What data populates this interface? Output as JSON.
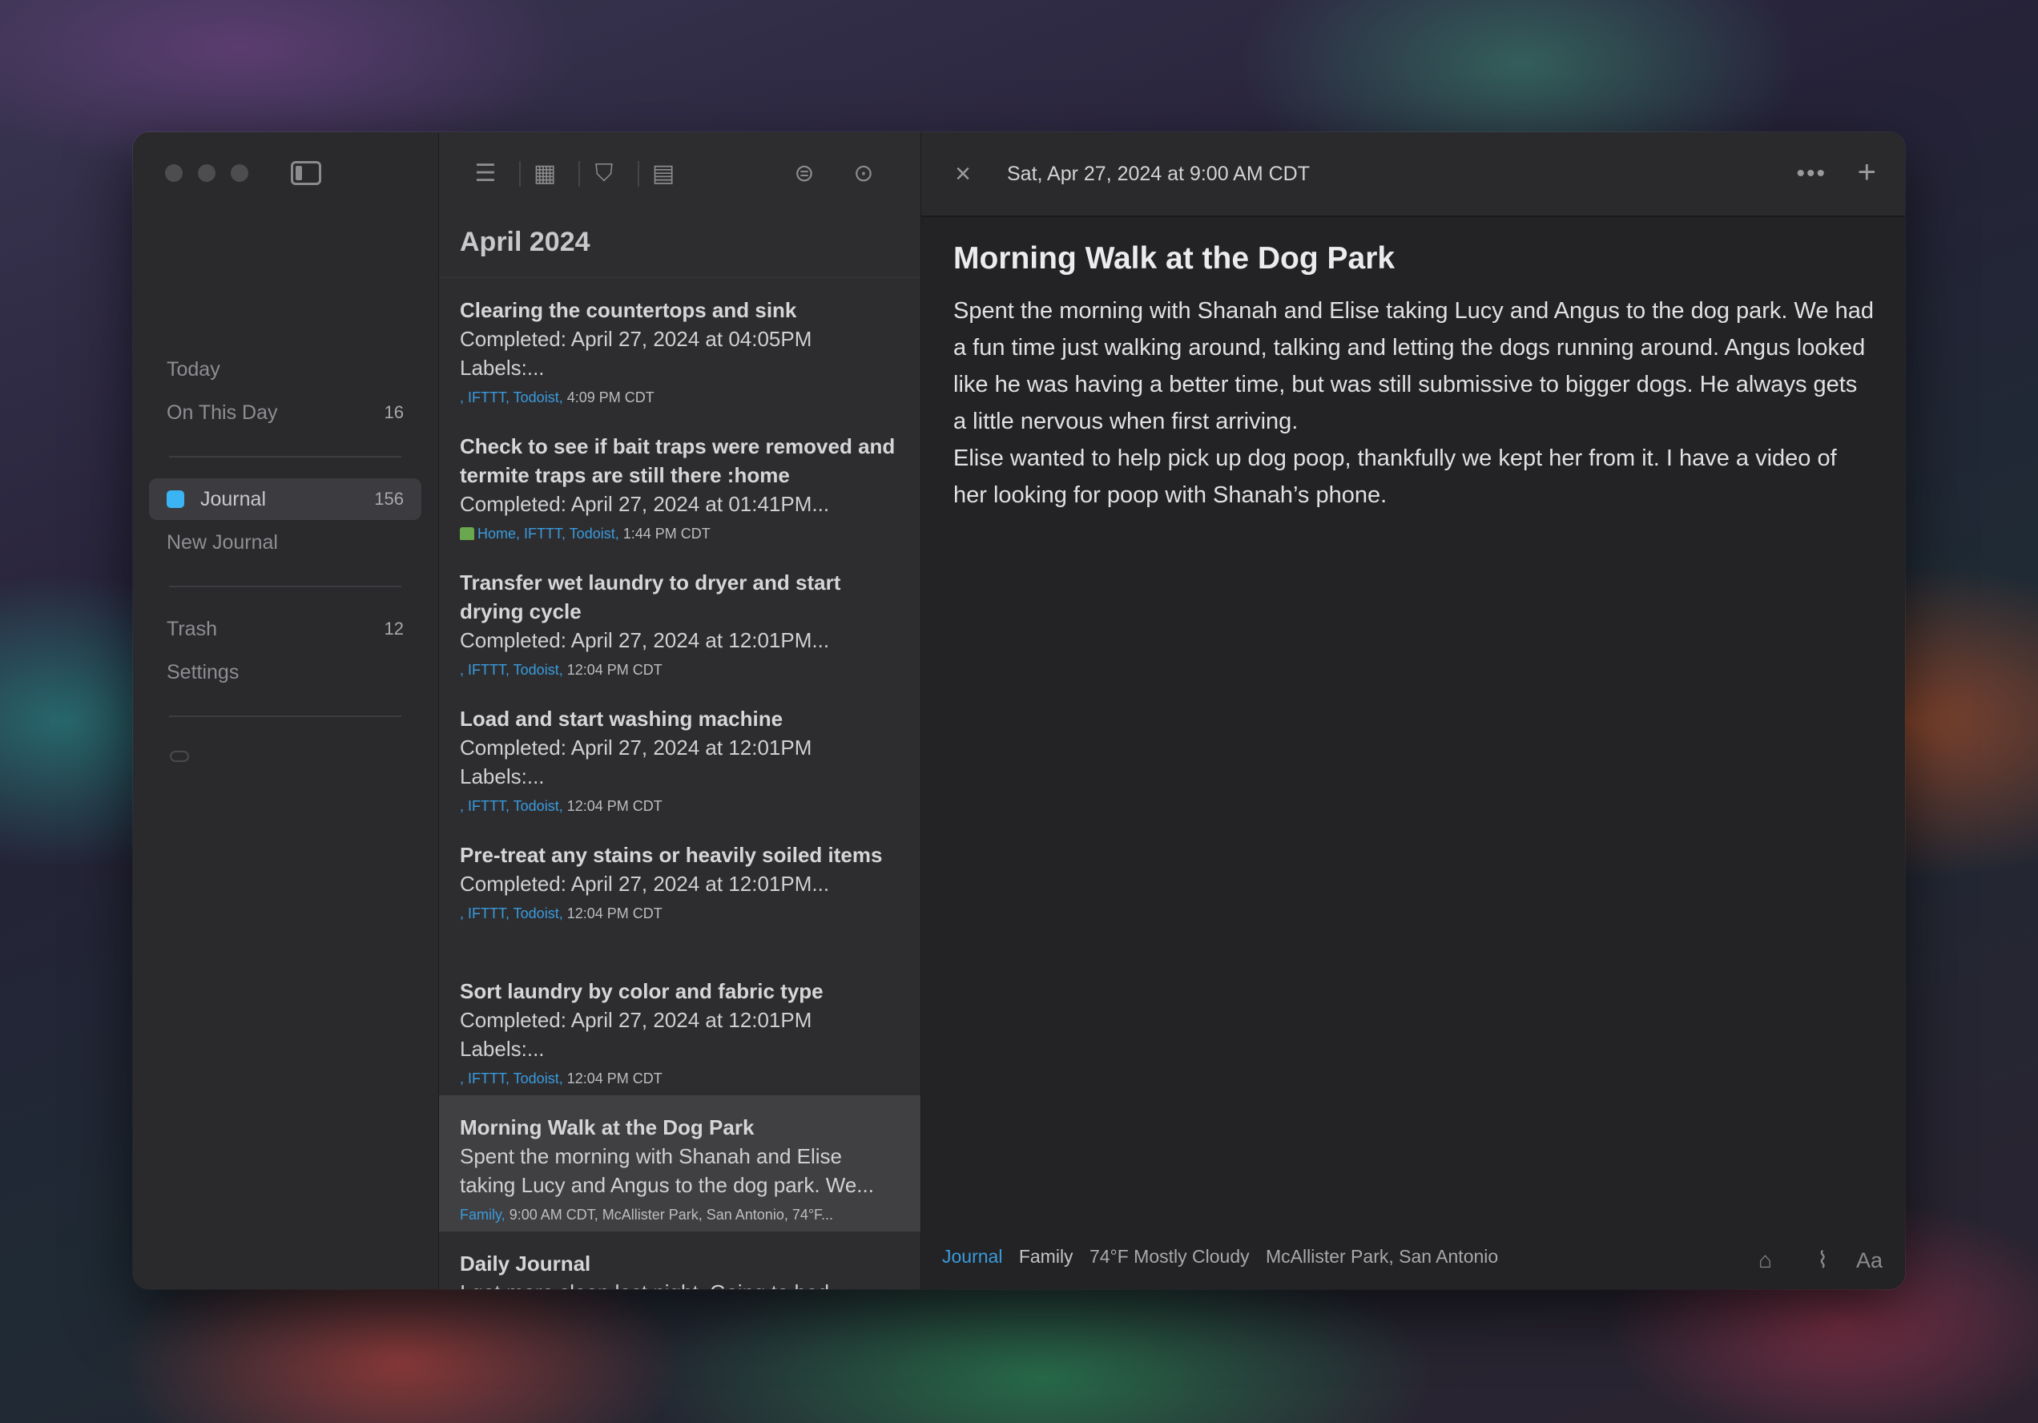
{
  "sidebar": {
    "today": "Today",
    "on_this_day": {
      "label": "On This Day",
      "count": "16"
    },
    "journal": {
      "label": "Journal",
      "count": "156"
    },
    "new_journal": "New Journal",
    "trash": {
      "label": "Trash",
      "count": "12"
    },
    "settings": "Settings"
  },
  "list": {
    "month_header": "April 2024",
    "entries": [
      {
        "title": "Clearing the countertops and sink",
        "body": "Completed: April 27, 2024 at 04:05PM Labels:...",
        "tags": ", IFTTT, Todoist,",
        "time": "4:09 PM CDT"
      },
      {
        "title": "Check to see if bait traps were removed and termite traps are still there :home",
        "body": "Completed: April 27, 2024 at 01:41PM...",
        "tags": "Home, IFTTT, Todoist,",
        "time": "1:44 PM CDT"
      },
      {
        "title": "Transfer wet laundry to dryer and start drying cycle",
        "body": "Completed: April 27, 2024 at 12:01PM...",
        "tags": ", IFTTT, Todoist,",
        "time": "12:04 PM CDT"
      },
      {
        "title": "Load and start washing machine",
        "body": "Completed: April 27, 2024 at 12:01PM Labels:...",
        "tags": ", IFTTT, Todoist,",
        "time": "12:04 PM CDT"
      },
      {
        "title": "Pre-treat any stains or heavily soiled items",
        "body": "Completed: April 27, 2024 at 12:01PM...",
        "tags": ", IFTTT, Todoist,",
        "time": "12:04 PM CDT"
      },
      {
        "title": "Sort laundry by color and fabric type",
        "body": "Completed: April 27, 2024 at 12:01PM Labels:...",
        "tags": ", IFTTT, Todoist,",
        "time": "12:04 PM CDT"
      },
      {
        "title": "Morning Walk at the Dog Park",
        "body": "Spent the morning with Shanah and Elise taking Lucy and Angus to the dog park. We...",
        "tags": "Family,",
        "time": "9:00 AM CDT,  McAllister Park, San Antonio,  74°F..."
      },
      {
        "title": "Daily Journal",
        "body": "I got more sleep last night. Going to bed..."
      }
    ]
  },
  "detail": {
    "date": "Sat, Apr 27, 2024 at 9:00 AM CDT",
    "title": "Morning Walk at the Dog Park",
    "paragraph1": "Spent the morning with Shanah and Elise taking Lucy and Angus to the dog park. We had a fun time just walking around, talking and letting the dogs running around. Angus looked like he was having a better time, but was still submissive to bigger dogs. He always gets a little nervous when first arriving.",
    "paragraph2": "Elise wanted to help pick up dog poop, thankfully we kept her from it. I have a video of her looking for poop with Shanah’s phone.",
    "footer": {
      "journal": "Journal",
      "tag": "Family",
      "weather": "74°F Mostly Cloudy",
      "location": "McAllister Park, San Antonio",
      "font_label": "Aa"
    }
  },
  "colors": {
    "accent": "#3a9bdc",
    "journal_dot": "#3ab4f2",
    "background": "#232325"
  },
  "icons": [
    "sidebar-toggle-icon",
    "list-view-icon",
    "grid-view-icon",
    "map-view-icon",
    "calendar-view-icon",
    "filter-icon",
    "search-icon",
    "close-icon",
    "more-icon",
    "plus-icon",
    "tag-icon",
    "attachment-icon",
    "cloud-icon",
    "house-icon"
  ]
}
